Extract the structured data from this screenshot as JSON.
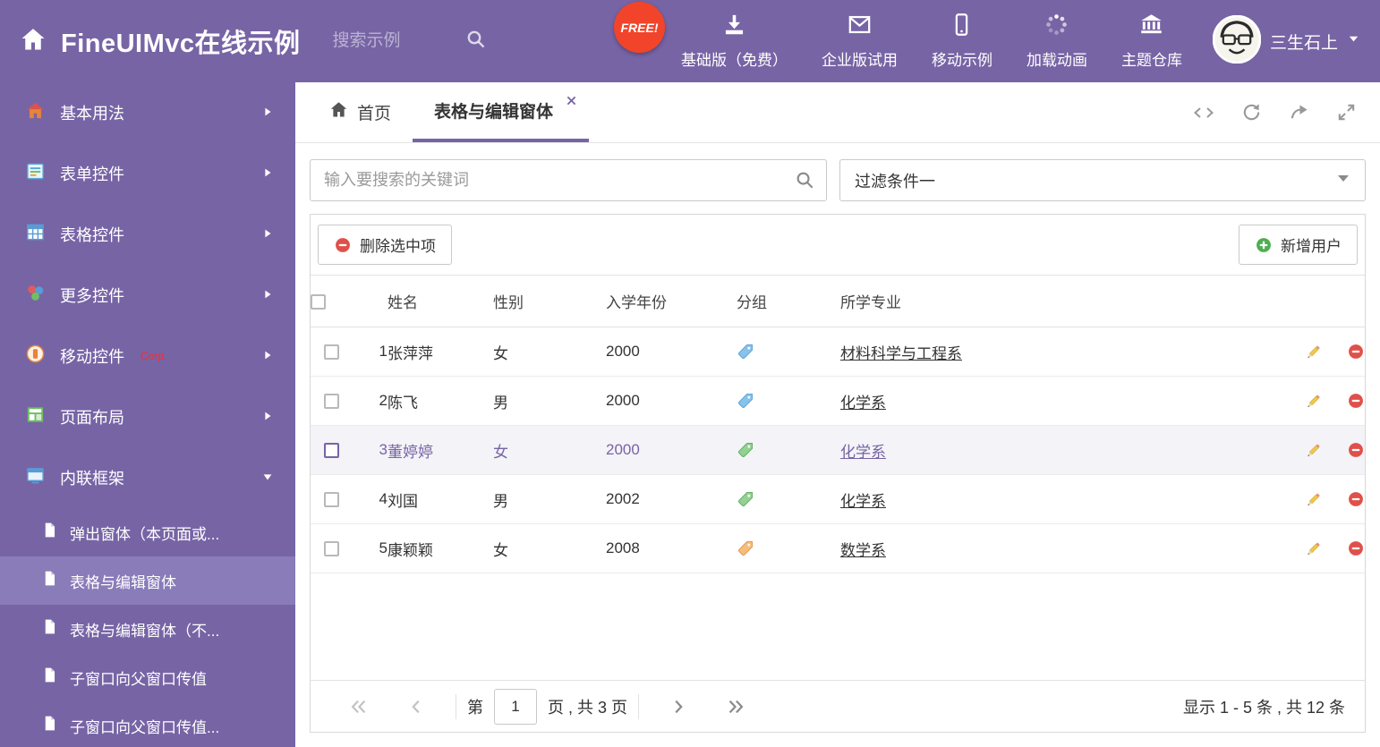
{
  "header": {
    "title": "FineUIMvc在线示例",
    "search_placeholder": "搜索示例",
    "free_badge": "FREE!",
    "nav_items": [
      {
        "label": "基础版（免费）",
        "icon": "download-icon"
      },
      {
        "label": "企业版试用",
        "icon": "envelope-icon"
      },
      {
        "label": "移动示例",
        "icon": "mobile-icon"
      },
      {
        "label": "加载动画",
        "icon": "spinner-icon"
      },
      {
        "label": "主题仓库",
        "icon": "bank-icon"
      }
    ],
    "user_name": "三生石上"
  },
  "sidebar": {
    "items": [
      {
        "label": "基本用法"
      },
      {
        "label": "表单控件"
      },
      {
        "label": "表格控件"
      },
      {
        "label": "更多控件"
      },
      {
        "label": "移动控件",
        "badge": "Corp."
      },
      {
        "label": "页面布局"
      },
      {
        "label": "内联框架",
        "expanded": true
      }
    ],
    "sub_items": [
      {
        "label": "弹出窗体（本页面或..."
      },
      {
        "label": "表格与编辑窗体",
        "active": true
      },
      {
        "label": "表格与编辑窗体（不..."
      },
      {
        "label": "子窗口向父窗口传值"
      },
      {
        "label": "子窗口向父窗口传值..."
      }
    ]
  },
  "tabs": [
    {
      "label": "首页"
    },
    {
      "label": "表格与编辑窗体",
      "active": true,
      "closable": true
    }
  ],
  "filter": {
    "search_placeholder": "输入要搜索的关键词",
    "dropdown_value": "过滤条件一"
  },
  "grid": {
    "toolbar": {
      "delete_label": "删除选中项",
      "add_label": "新增用户"
    },
    "columns": [
      "姓名",
      "性别",
      "入学年份",
      "分组",
      "所学专业"
    ],
    "rows": [
      {
        "num": "1",
        "name": "张萍萍",
        "gender": "女",
        "year": "2000",
        "tag": "blue",
        "major": "材料科学与工程系",
        "selected": false
      },
      {
        "num": "2",
        "name": "陈飞",
        "gender": "男",
        "year": "2000",
        "tag": "blue",
        "major": "化学系",
        "selected": false
      },
      {
        "num": "3",
        "name": "董婷婷",
        "gender": "女",
        "year": "2000",
        "tag": "green",
        "major": "化学系",
        "selected": true
      },
      {
        "num": "4",
        "name": "刘国",
        "gender": "男",
        "year": "2002",
        "tag": "green",
        "major": "化学系",
        "selected": false
      },
      {
        "num": "5",
        "name": "康颖颖",
        "gender": "女",
        "year": "2008",
        "tag": "orange",
        "major": "数学系",
        "selected": false
      }
    ],
    "pagination": {
      "page_prefix": "第",
      "current_page": "1",
      "page_suffix": "页 , 共 3 页",
      "summary": "显示 1 - 5 条 , 共 12 条"
    }
  },
  "colors": {
    "accent": "#7764a5",
    "sidebar_active": "#8a7bb9",
    "free_badge_bg": "#f2442a",
    "delete_red": "#e0504a",
    "add_green": "#4caf50",
    "tags": {
      "blue": {
        "fill": "#87c3ea",
        "stroke": "#62a4d6"
      },
      "green": {
        "fill": "#93d193",
        "stroke": "#63b063"
      },
      "orange": {
        "fill": "#f6bd7d",
        "stroke": "#e09a4e"
      }
    }
  }
}
